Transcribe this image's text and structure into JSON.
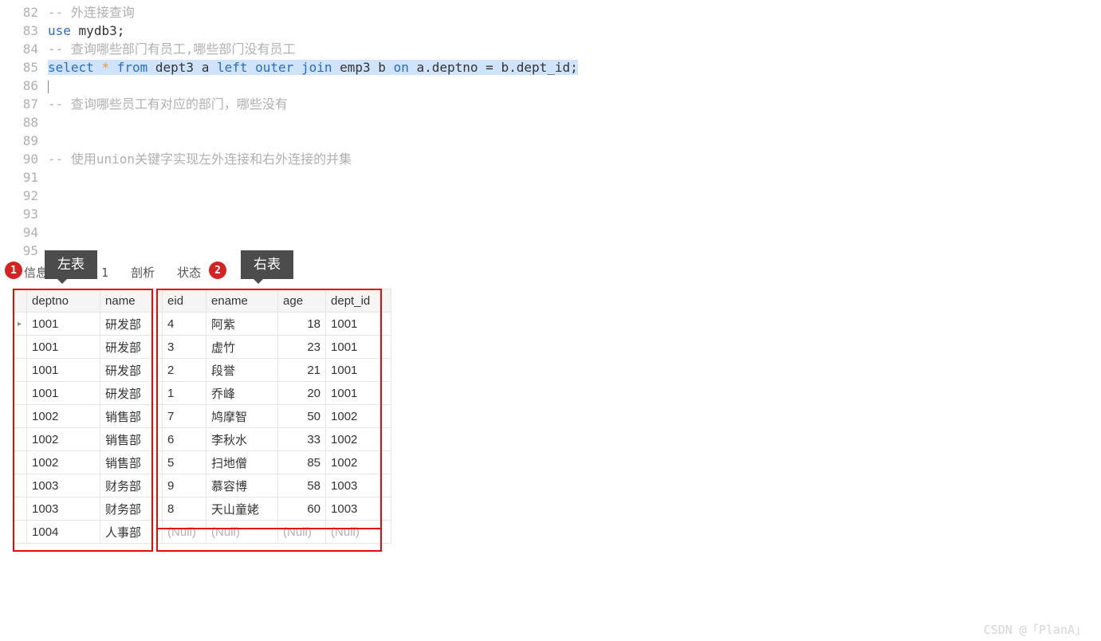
{
  "code": {
    "lines": [
      {
        "num": "82",
        "comment": "-- 外连接查询"
      },
      {
        "num": "83",
        "seg": [
          [
            "kw",
            "use"
          ],
          [
            "sp",
            " "
          ],
          [
            "ident",
            "mydb3"
          ],
          [
            "op",
            ";"
          ]
        ]
      },
      {
        "num": "84",
        "comment": "-- 查询哪些部门有员工,哪些部门没有员工"
      },
      {
        "num": "85",
        "highlight": true,
        "seg": [
          [
            "kw",
            "select"
          ],
          [
            "sp",
            " "
          ],
          [
            "star",
            "*"
          ],
          [
            "sp",
            " "
          ],
          [
            "kw",
            "from"
          ],
          [
            "sp",
            " "
          ],
          [
            "ident",
            "dept3 a"
          ],
          [
            "sp",
            " "
          ],
          [
            "kw",
            "left"
          ],
          [
            "sp",
            " "
          ],
          [
            "kw",
            "outer"
          ],
          [
            "sp",
            " "
          ],
          [
            "kw",
            "join"
          ],
          [
            "sp",
            " "
          ],
          [
            "ident",
            "emp3 b"
          ],
          [
            "sp",
            " "
          ],
          [
            "kw",
            "on"
          ],
          [
            "sp",
            " "
          ],
          [
            "ident",
            "a.deptno"
          ],
          [
            "sp",
            " "
          ],
          [
            "op",
            "="
          ],
          [
            "sp",
            " "
          ],
          [
            "ident",
            "b.dept_id"
          ],
          [
            "op",
            ";"
          ]
        ]
      },
      {
        "num": "86",
        "caret": true
      },
      {
        "num": "87",
        "comment": "-- 查询哪些员工有对应的部门，哪些没有"
      },
      {
        "num": "88"
      },
      {
        "num": "89"
      },
      {
        "num": "90",
        "comment": "-- 使用union关键字实现左外连接和右外连接的并集"
      },
      {
        "num": "91"
      },
      {
        "num": "92"
      },
      {
        "num": "93"
      },
      {
        "num": "94"
      },
      {
        "num": "95"
      }
    ]
  },
  "tabs": {
    "labels": [
      "信息",
      "结果 1",
      "剖析",
      "状态"
    ]
  },
  "annotations": {
    "badge1": "1",
    "tip1": "左表",
    "badge2": "2",
    "tip2": "右表"
  },
  "table": {
    "headers": [
      "deptno",
      "name",
      "eid",
      "ename",
      "age",
      "dept_id"
    ],
    "rows": [
      {
        "deptno": "1001",
        "name": "研发部",
        "eid": "4",
        "ename": "阿紫",
        "age": "18",
        "dept_id": "1001",
        "active": true
      },
      {
        "deptno": "1001",
        "name": "研发部",
        "eid": "3",
        "ename": "虚竹",
        "age": "23",
        "dept_id": "1001"
      },
      {
        "deptno": "1001",
        "name": "研发部",
        "eid": "2",
        "ename": "段誉",
        "age": "21",
        "dept_id": "1001"
      },
      {
        "deptno": "1001",
        "name": "研发部",
        "eid": "1",
        "ename": "乔峰",
        "age": "20",
        "dept_id": "1001"
      },
      {
        "deptno": "1002",
        "name": "销售部",
        "eid": "7",
        "ename": "鸠摩智",
        "age": "50",
        "dept_id": "1002"
      },
      {
        "deptno": "1002",
        "name": "销售部",
        "eid": "6",
        "ename": "李秋水",
        "age": "33",
        "dept_id": "1002"
      },
      {
        "deptno": "1002",
        "name": "销售部",
        "eid": "5",
        "ename": "扫地僧",
        "age": "85",
        "dept_id": "1002"
      },
      {
        "deptno": "1003",
        "name": "财务部",
        "eid": "9",
        "ename": "慕容博",
        "age": "58",
        "dept_id": "1003"
      },
      {
        "deptno": "1003",
        "name": "财务部",
        "eid": "8",
        "ename": "天山童姥",
        "age": "60",
        "dept_id": "1003"
      },
      {
        "deptno": "1004",
        "name": "人事部",
        "eid": "(Null)",
        "ename": "(Null)",
        "age": "(Null)",
        "dept_id": "(Null)",
        "null_right": true
      }
    ],
    "col_widths": {
      "marker": 6,
      "deptno": 92,
      "name": 78,
      "eid": 55,
      "ename": 90,
      "age": 60,
      "dept_id": 82
    }
  },
  "watermark": "CSDN @「PlanA」"
}
